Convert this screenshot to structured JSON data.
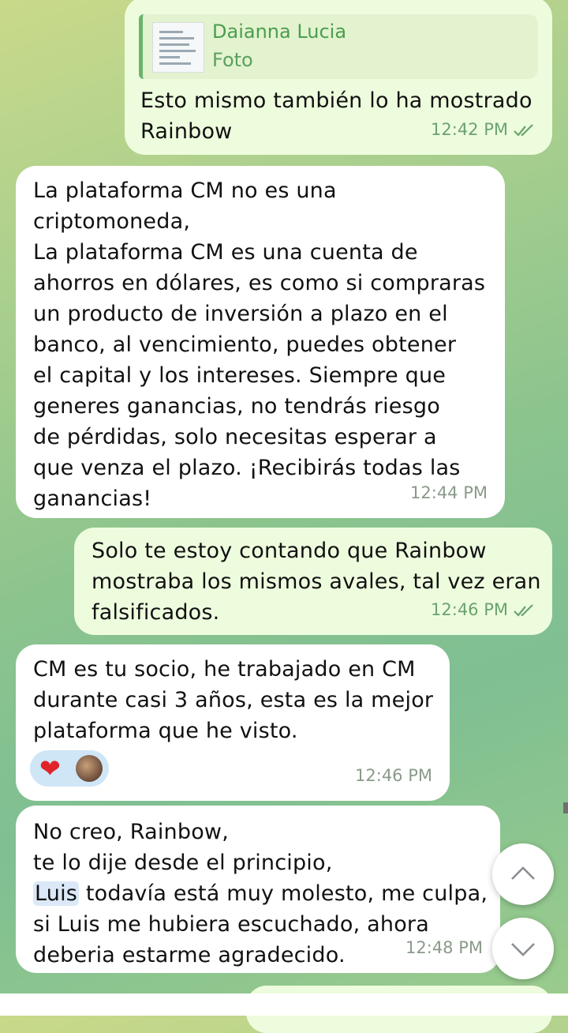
{
  "messages": [
    {
      "direction": "outgoing",
      "reply_to": {
        "name": "Daianna Lucia",
        "type": "Foto"
      },
      "text": "Esto mismo también lo ha mostrado\nRainbow",
      "time": "12:42 PM",
      "read": true
    },
    {
      "direction": "incoming",
      "text": "La plataforma CM no es una\ncriptomoneda,\nLa plataforma CM es una cuenta de\nahorros en dólares, es como si compraras\nun producto de inversión a plazo en el\nbanco, al vencimiento, puedes obtener\nel capital y los intereses. Siempre que\ngeneres ganancias, no tendrás riesgo\nde pérdidas, solo necesitas esperar a\nque venza el plazo. ¡Recibirás todas las\nganancias!",
      "time": "12:44 PM"
    },
    {
      "direction": "outgoing",
      "text": "Solo te estoy contando que Rainbow\nmostraba los mismos avales, tal vez eran\nfalsificados.",
      "time": "12:46 PM",
      "read": true
    },
    {
      "direction": "incoming",
      "text": "CM es tu socio, he trabajado en CM\ndurante casi 3 años, esta es la mejor\nplataforma que he visto.",
      "time": "12:46 PM",
      "reactions": {
        "emoji": "❤",
        "has_avatar": true
      }
    },
    {
      "direction": "incoming",
      "text_before_mention": "No creo, Rainbow,\nte lo dije desde el principio,\n",
      "mention": "Luis",
      "text_after_mention": " todavía está muy molesto, me culpa,\nsi Luis me hubiera escuchado, ahora\ndeberia estarme agradecido.",
      "time": "12:48 PM"
    }
  ],
  "controls": {
    "scroll_up_icon": "chevron-up-icon",
    "scroll_down_icon": "chevron-down-icon"
  },
  "colors": {
    "incoming_bubble": "#ffffff",
    "outgoing_bubble": "#eefcde",
    "read_check": "#6aa36e",
    "reply_accent": "#6cb36e",
    "heart": "#e0242a"
  }
}
